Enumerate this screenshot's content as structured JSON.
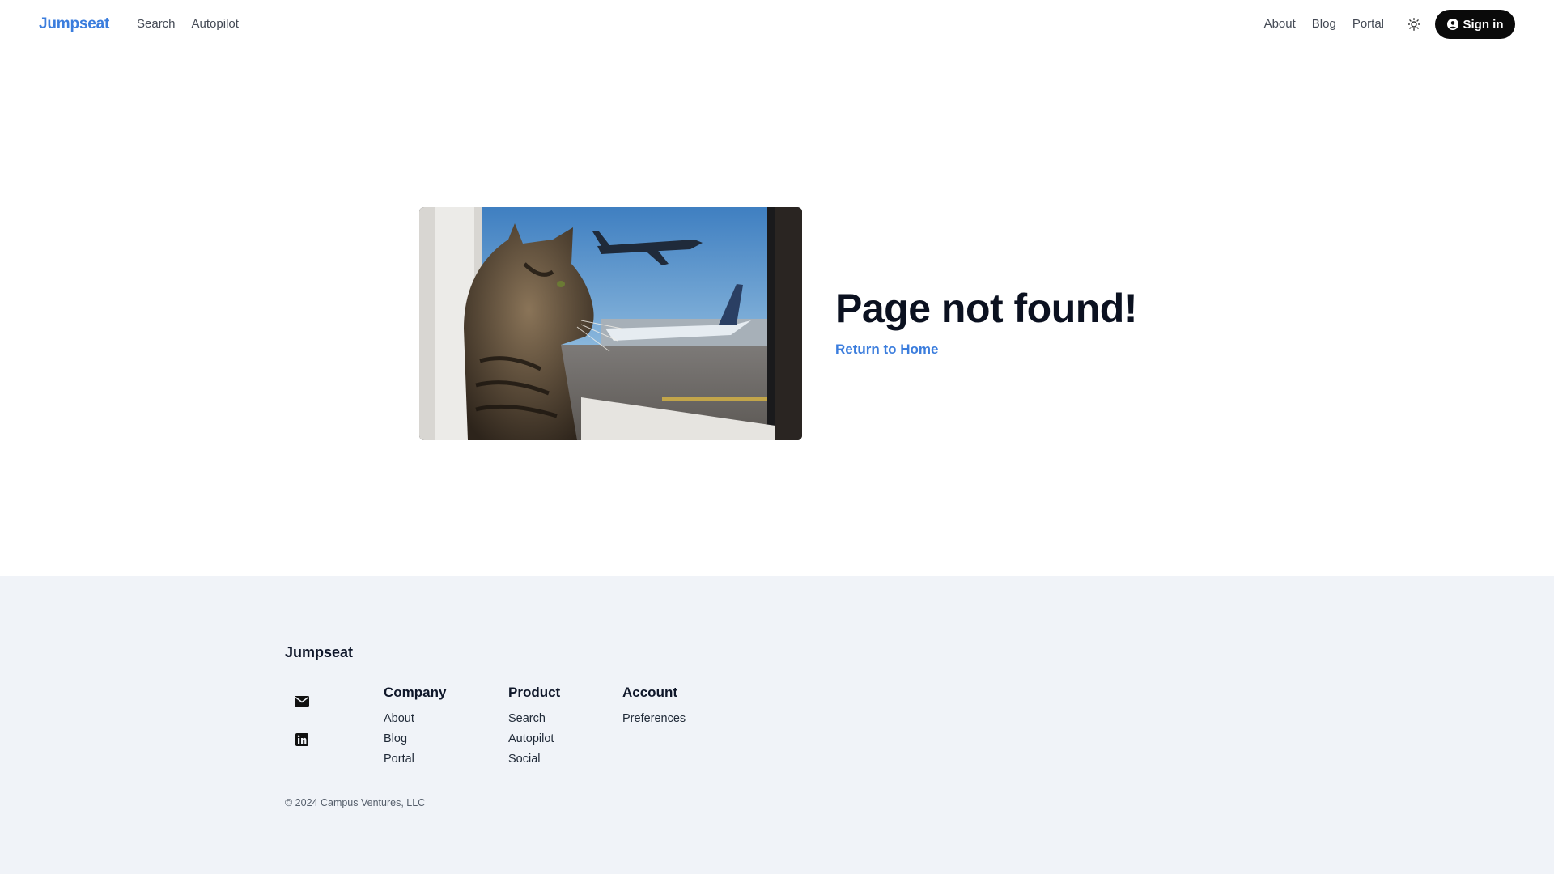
{
  "header": {
    "brand": "Jumpseat",
    "nav_left": [
      "Search",
      "Autopilot"
    ],
    "nav_right": [
      "About",
      "Blog",
      "Portal"
    ],
    "theme_toggle_icon": "sun-icon",
    "signin_label": "Sign in",
    "signin_icon": "user-circle-icon",
    "brand_color": "#3b7ddd"
  },
  "main": {
    "image_icon": "cat-at-airplane-window-photo",
    "headline": "Page not found!",
    "return_link": "Return to Home"
  },
  "footer": {
    "brand": "Jumpseat",
    "social_icons": [
      "envelope-icon",
      "linkedin-icon"
    ],
    "columns": [
      {
        "title": "Company",
        "links": [
          "About",
          "Blog",
          "Portal"
        ]
      },
      {
        "title": "Product",
        "links": [
          "Search",
          "Autopilot",
          "Social"
        ]
      },
      {
        "title": "Account",
        "links": [
          "Preferences"
        ]
      }
    ],
    "copyright": "© 2024 Campus Ventures, LLC",
    "background": "#f0f3f8"
  }
}
